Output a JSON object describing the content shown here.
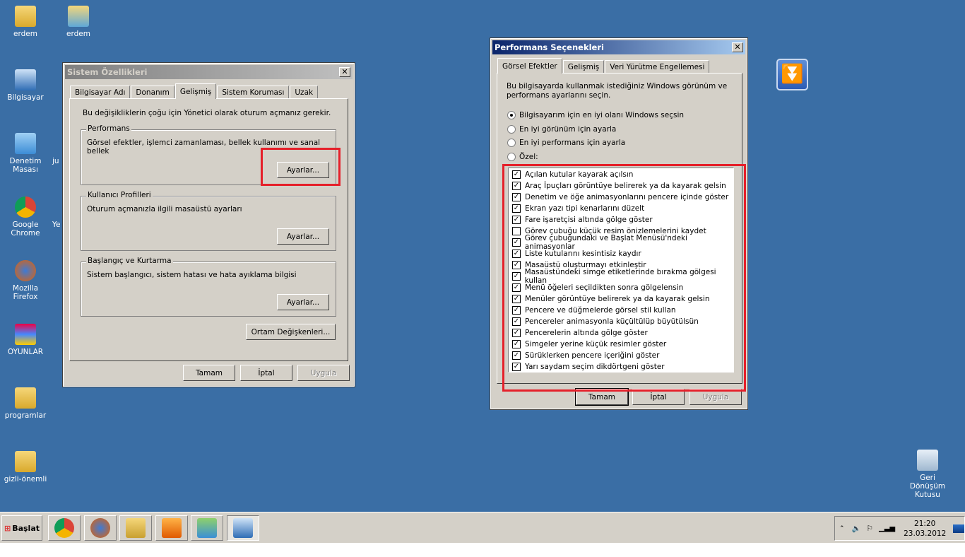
{
  "desktop": {
    "icons": [
      {
        "label": "erdem",
        "icon": "folder-user-icon"
      },
      {
        "label": "erdem",
        "icon": "user-shortcut-icon"
      },
      {
        "label": "Bilgisayar",
        "icon": "computer-icon"
      },
      {
        "label": "Denetim Masası",
        "icon": "control-panel-icon"
      },
      {
        "label": "Google Chrome",
        "icon": "chrome-icon"
      },
      {
        "label": "Mozilla Firefox",
        "icon": "firefox-icon"
      },
      {
        "label": "OYUNLAR",
        "icon": "games-icon"
      },
      {
        "label": "programlar",
        "icon": "folder-icon"
      },
      {
        "label": "gizli-önemli",
        "icon": "folder-icon"
      },
      {
        "label": "Geri Dönüşüm Kutusu",
        "icon": "recycle-bin-icon"
      },
      {
        "label": "ju",
        "icon": "partial-icon"
      },
      {
        "label": "Ye",
        "icon": "partial-icon"
      }
    ]
  },
  "sys": {
    "title": "Sistem Özellikleri",
    "tabs": [
      "Bilgisayar Adı",
      "Donanım",
      "Gelişmiş",
      "Sistem Koruması",
      "Uzak"
    ],
    "selected_tab": "Gelişmiş",
    "note": "Bu değişikliklerin çoğu için Yönetici olarak oturum açmanız gerekir.",
    "groups": [
      {
        "title": "Performans",
        "desc": "Görsel efektler, işlemci zamanlaması, bellek kullanımı ve sanal bellek",
        "button": "Ayarlar..."
      },
      {
        "title": "Kullanıcı Profilleri",
        "desc": "Oturum açmanızla ilgili masaüstü ayarları",
        "button": "Ayarlar..."
      },
      {
        "title": "Başlangıç ve Kurtarma",
        "desc": "Sistem başlangıcı, sistem hatası ve hata ayıklama bilgisi",
        "button": "Ayarlar..."
      }
    ],
    "env_button": "Ortam Değişkenleri...",
    "ok": "Tamam",
    "cancel": "İptal",
    "apply": "Uygula"
  },
  "perf": {
    "title": "Performans Seçenekleri",
    "tabs": [
      "Görsel Efektler",
      "Gelişmiş",
      "Veri Yürütme Engellemesi"
    ],
    "selected_tab": "Görsel Efektler",
    "intro": "Bu bilgisayarda kullanmak istediğiniz Windows görünüm ve performans ayarlarını seçin.",
    "radios": [
      {
        "label": "Bilgisayarım için en iyi olanı Windows seçsin",
        "checked": true
      },
      {
        "label": "En iyi görünüm için ayarla",
        "checked": false
      },
      {
        "label": "En iyi performans için ayarla",
        "checked": false
      },
      {
        "label": "Özel:",
        "checked": false
      }
    ],
    "effects": [
      {
        "label": "Açılan kutular kayarak açılsın",
        "checked": true
      },
      {
        "label": "Araç İpuçları görüntüye belirerek ya da kayarak gelsin",
        "checked": true
      },
      {
        "label": "Denetim ve öğe animasyonlarını pencere içinde göster",
        "checked": true
      },
      {
        "label": "Ekran yazı tipi kenarlarını düzelt",
        "checked": true
      },
      {
        "label": "Fare işaretçisi altında gölge göster",
        "checked": true
      },
      {
        "label": "Görev çubuğu küçük resim önizlemelerini kaydet",
        "checked": false
      },
      {
        "label": "Görev çubuğundaki ve Başlat Menüsü'ndeki animasyonlar",
        "checked": true
      },
      {
        "label": "Liste kutularını kesintisiz kaydır",
        "checked": true
      },
      {
        "label": "Masaüstü oluşturmayı etkinleştir",
        "checked": true
      },
      {
        "label": "Masaüstündeki simge etiketlerinde bırakma gölgesi kullan",
        "checked": true
      },
      {
        "label": "Menü öğeleri seçildikten sonra gölgelensin",
        "checked": true
      },
      {
        "label": "Menüler görüntüye belirerek ya da kayarak gelsin",
        "checked": true
      },
      {
        "label": "Pencere ve düğmelerde görsel stil kullan",
        "checked": true
      },
      {
        "label": "Pencereler animasyonla küçültülüp büyütülsün",
        "checked": true
      },
      {
        "label": "Pencerelerin altında gölge göster",
        "checked": true
      },
      {
        "label": "Simgeler yerine küçük resimler göster",
        "checked": true
      },
      {
        "label": "Sürüklerken pencere içeriğini göster",
        "checked": true
      },
      {
        "label": "Yarı saydam seçim dikdörtgeni göster",
        "checked": true
      }
    ],
    "ok": "Tamam",
    "cancel": "İptal",
    "apply": "Uygula"
  },
  "taskbar": {
    "start": "Başlat",
    "clock_time": "21:20",
    "clock_date": "23.03.2012",
    "buttons": [
      "chrome-icon",
      "firefox-icon",
      "explorer-icon",
      "media-player-icon",
      "users-icon",
      "system-properties-icon"
    ]
  },
  "colors": {
    "desktop": "#3a6ea5",
    "highlight": "#e5202a",
    "active_title": "#0a246a"
  }
}
